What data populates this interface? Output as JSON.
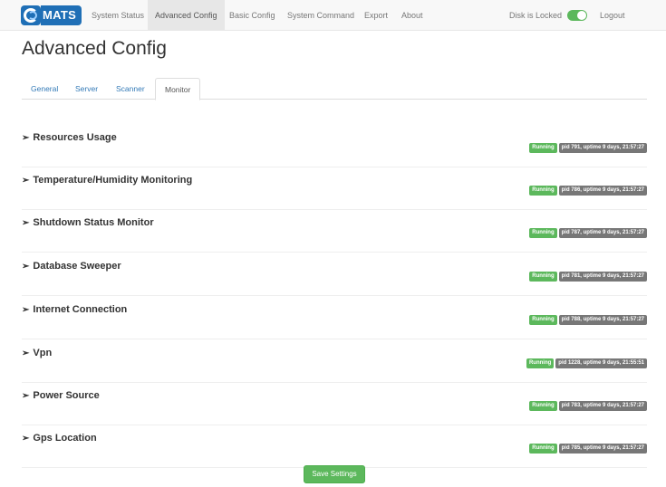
{
  "brand": {
    "logo_text": "MATS"
  },
  "nav": {
    "items": [
      {
        "label": "System Status"
      },
      {
        "label": "Advanced Config"
      },
      {
        "label": "Basic Config"
      },
      {
        "label": "System Command"
      },
      {
        "label": "Export"
      },
      {
        "label": "About"
      }
    ],
    "disk_lock_label": "Disk is Locked",
    "disk_locked": true,
    "logout_label": "Logout"
  },
  "page": {
    "title": "Advanced Config"
  },
  "tabs": [
    {
      "label": "General"
    },
    {
      "label": "Server"
    },
    {
      "label": "Scanner"
    },
    {
      "label": "Monitor",
      "active": true
    }
  ],
  "monitors": [
    {
      "name": "Resources Usage",
      "status": "Running",
      "pid": "pid 791, uptime 9 days, 21:57:27"
    },
    {
      "name": "Temperature/Humidity Monitoring",
      "status": "Running",
      "pid": "pid 786, uptime 9 days, 21:57:27"
    },
    {
      "name": "Shutdown Status Monitor",
      "status": "Running",
      "pid": "pid 787, uptime 9 days, 21:57:27"
    },
    {
      "name": "Database Sweeper",
      "status": "Running",
      "pid": "pid 781, uptime 9 days, 21:57:27"
    },
    {
      "name": "Internet Connection",
      "status": "Running",
      "pid": "pid 788, uptime 9 days, 21:57:27"
    },
    {
      "name": "Vpn",
      "status": "Running",
      "pid": "pid 1228, uptime 9 days, 21:55:51"
    },
    {
      "name": "Power Source",
      "status": "Running",
      "pid": "pid 783, uptime 9 days, 21:57:27"
    },
    {
      "name": "Gps Location",
      "status": "Running",
      "pid": "pid 785, uptime 9 days, 21:57:27"
    }
  ],
  "actions": {
    "save_label": "Save Settings"
  },
  "colors": {
    "running": "#5cb85c",
    "pid": "#777777",
    "brand": "#1f6fb6",
    "link": "#337ab7"
  }
}
